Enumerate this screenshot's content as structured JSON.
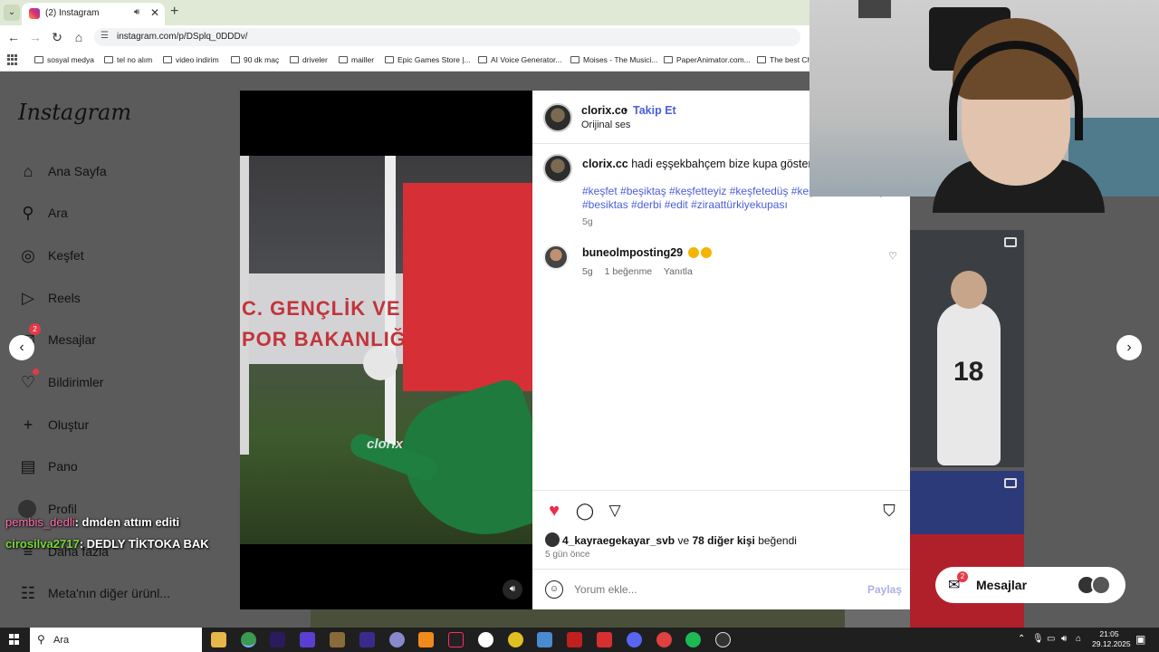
{
  "browser": {
    "tab_title": "(2) Instagram",
    "url": "instagram.com/p/DSplq_0DDDv/",
    "bookmarks": [
      "sosyal medya",
      "tel no alım",
      "video indirim",
      "90 dk maç",
      "driveler",
      "mailler",
      "Epic Games Store |...",
      "AI Voice Generator...",
      "Moises - The Musici...",
      "PaperAnimator.com...",
      "The best Ch"
    ]
  },
  "sidebar": {
    "logo": "Instagram",
    "items": [
      {
        "label": "Ana Sayfa",
        "icon": "home-icon"
      },
      {
        "label": "Ara",
        "icon": "search-icon"
      },
      {
        "label": "Keşfet",
        "icon": "compass-icon"
      },
      {
        "label": "Reels",
        "icon": "reels-icon"
      },
      {
        "label": "Mesajlar",
        "icon": "messenger-icon",
        "badge": "2"
      },
      {
        "label": "Bildirimler",
        "icon": "heart-icon"
      },
      {
        "label": "Oluştur",
        "icon": "plus-icon"
      },
      {
        "label": "Pano",
        "icon": "dashboard-icon"
      },
      {
        "label": "Profil",
        "icon": "avatar"
      },
      {
        "label": "Daha fazla",
        "icon": "menu-icon"
      },
      {
        "label": "Meta'nın diğer ürünl...",
        "icon": "grid-icon"
      }
    ]
  },
  "video": {
    "banner_line1": "C. GENÇLİK VE",
    "banner_line2": "POR BAKANLIĞ",
    "watermark": "clorix"
  },
  "post": {
    "username": "clorix.cc",
    "follow_label": "Takip Et",
    "audio": "Orijinal ses",
    "caption": "hadi eşşekbahçem bize kupa göster",
    "hashtags": "#keşfet #beşiktaş #keşfetteyiz #keşfetedüş #keşfet #fenerbahçe #besiktas #derbi #edit #ziraattürkiyekupası",
    "caption_age": "5g",
    "comment": {
      "username": "buneolmposting29",
      "age": "5g",
      "likes": "1 beğenme",
      "reply": "Yanıtla"
    },
    "liked_by_user": "4_kayraegekayar_svb",
    "liked_by_mid": "ve",
    "liked_by_others": "78 diğer kişi",
    "liked_by_suffix": "beğendi",
    "posted_ago": "5 gün önce",
    "comment_placeholder": "Yorum ekle...",
    "share_label": "Paylaş"
  },
  "messages_pill": {
    "label": "Mesajlar",
    "badge": "2"
  },
  "chat": [
    {
      "user": "pembis_dedli",
      "message": ": dmden attım editi"
    },
    {
      "user": "cirosilva2717",
      "message": ": DEDLY TİKTOKA BAK"
    }
  ],
  "thumb": {
    "jersey_number": "18"
  },
  "taskbar": {
    "search_label": "Ara",
    "time": "21:05",
    "date": "29.12.2025"
  },
  "colors": {
    "accent_blue": "#4a5ed8",
    "like_red": "#ed2c4b",
    "chrome_tabbar": "#dfe9d5"
  }
}
